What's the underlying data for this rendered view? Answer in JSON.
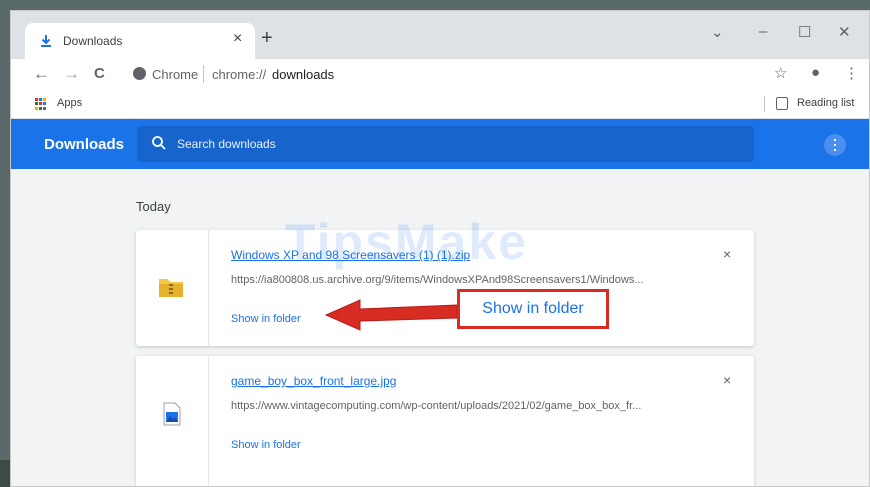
{
  "tab": {
    "title": "Downloads",
    "close": "×",
    "new_tab": "+"
  },
  "window_controls": {
    "dropdown": "⌄",
    "minimize": "–",
    "maximize": "☐",
    "close": "✕"
  },
  "toolbar": {
    "back": "←",
    "forward": "→",
    "reload": "C",
    "chip": "Chrome",
    "url_scheme": "chrome://",
    "url_host": "downloads",
    "bookmark_star": "☆",
    "profile": "●",
    "menu": "⋮"
  },
  "bookmarks": {
    "apps": "Apps",
    "reading_list": "Reading list"
  },
  "header": {
    "title": "Downloads",
    "search_placeholder": "Search downloads"
  },
  "section": {
    "date_label": "Today"
  },
  "downloads": [
    {
      "name": "Windows XP and 98 Screensavers (1) (1).zip",
      "url": "https://ia800808.us.archive.org/9/items/WindowsXPAnd98Screensavers1/Windows...",
      "action": "Show in folder",
      "close": "×",
      "file_icon": "zip-folder-icon"
    },
    {
      "name": "game_boy_box_front_large.jpg",
      "url": "https://www.vintagecomputing.com/wp-content/uploads/2021/02/game_box_box_fr...",
      "action": "Show in folder",
      "close": "×",
      "file_icon": "image-file-icon"
    }
  ],
  "annotation": {
    "callout": "Show in folder",
    "color": "#d62c22"
  },
  "watermark": "TipsMake",
  "colors": {
    "accent": "#1a73e8",
    "header_bg": "#1a73e8",
    "search_bg": "#1765cc"
  }
}
